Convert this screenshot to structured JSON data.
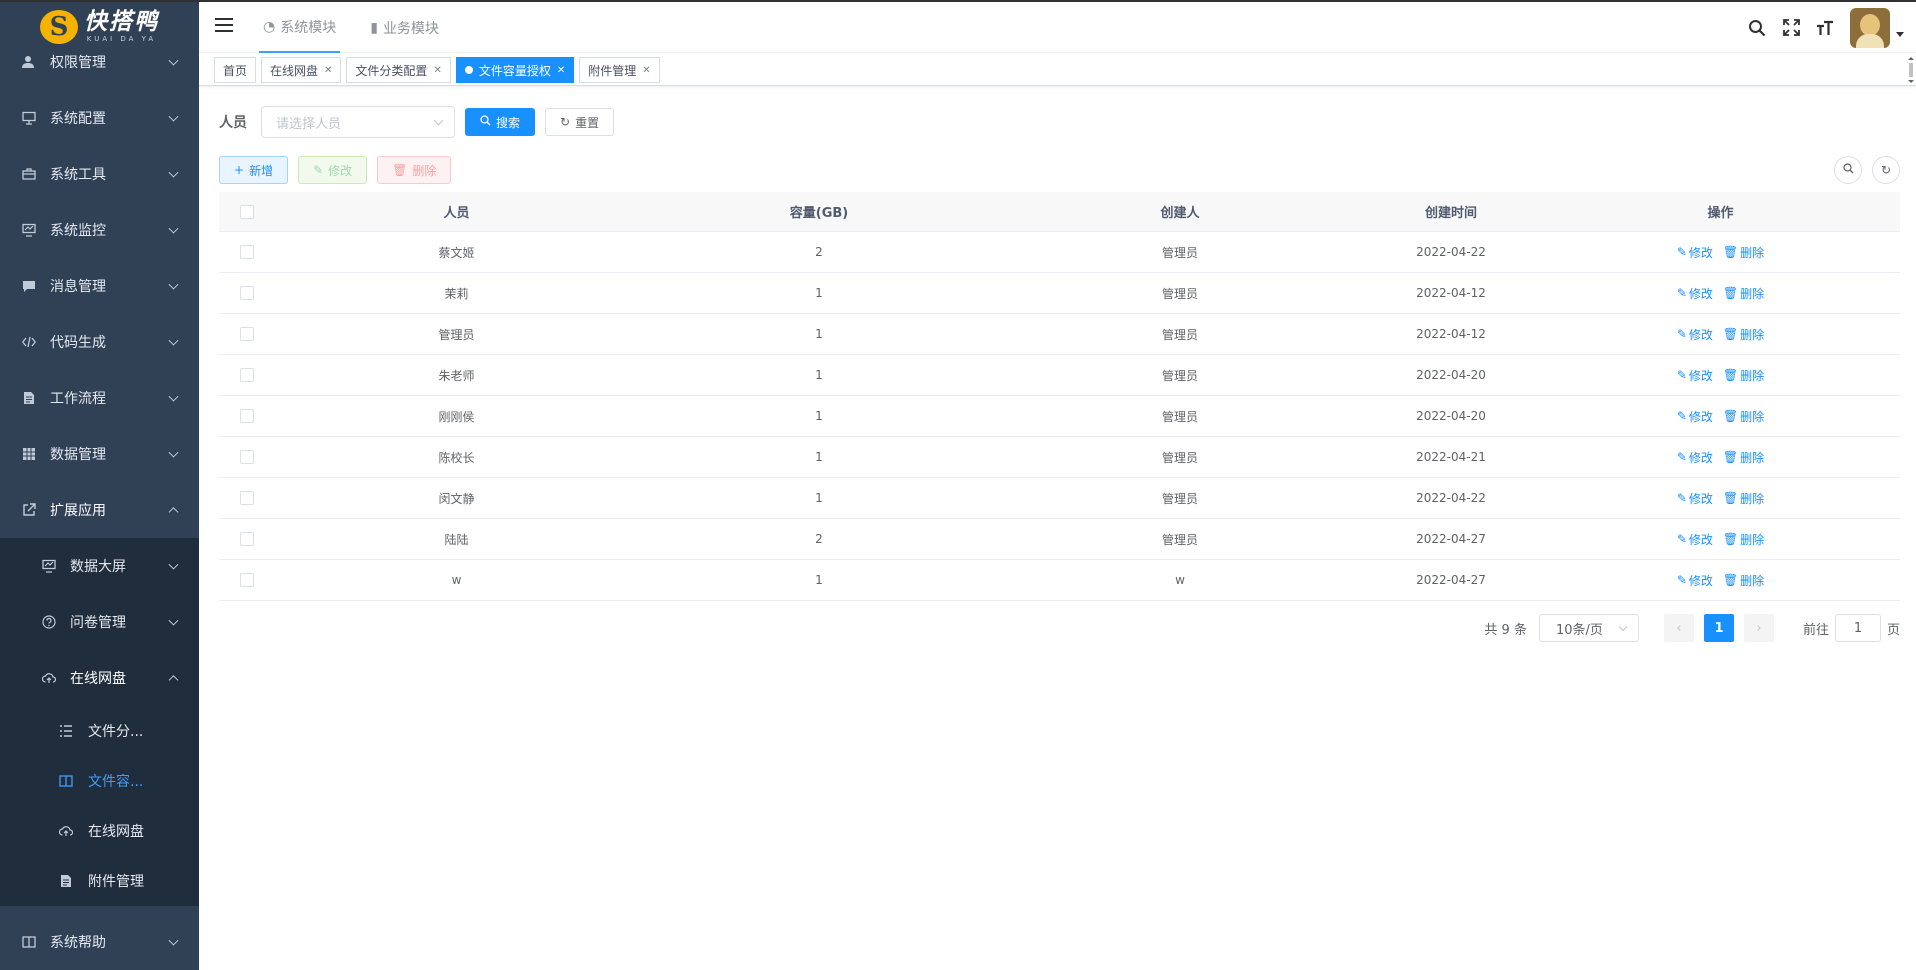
{
  "logo": {
    "mark": "S",
    "title": "快搭鸭",
    "subtitle": "KUAI DA YA"
  },
  "sidebar": {
    "items": [
      {
        "label": "权限管理",
        "icon": "user-icon"
      },
      {
        "label": "系统配置",
        "icon": "monitor-icon"
      },
      {
        "label": "系统工具",
        "icon": "toolbox-icon"
      },
      {
        "label": "系统监控",
        "icon": "chart-monitor-icon"
      },
      {
        "label": "消息管理",
        "icon": "message-icon"
      },
      {
        "label": "代码生成",
        "icon": "code-icon"
      },
      {
        "label": "工作流程",
        "icon": "document-icon"
      },
      {
        "label": "数据管理",
        "icon": "table-icon"
      },
      {
        "label": "扩展应用",
        "icon": "external-link-icon"
      }
    ],
    "ext_sub": [
      {
        "label": "数据大屏",
        "icon": "screen-icon"
      },
      {
        "label": "问卷管理",
        "icon": "question-icon"
      },
      {
        "label": "在线网盘",
        "icon": "cloud-upload-icon"
      }
    ],
    "disk_sub": [
      {
        "label": "文件分...",
        "icon": "list-icon"
      },
      {
        "label": "文件容...",
        "icon": "columns-icon"
      },
      {
        "label": "在线网盘",
        "icon": "cloud-upload-icon"
      },
      {
        "label": "附件管理",
        "icon": "file-icon"
      }
    ],
    "help": {
      "label": "系统帮助",
      "icon": "book-icon"
    }
  },
  "navbar": {
    "modules": [
      {
        "label": "系统模块",
        "icon": "dashboard-icon"
      },
      {
        "label": "业务模块",
        "icon": "door-icon"
      }
    ]
  },
  "tags": [
    {
      "label": "首页"
    },
    {
      "label": "在线网盘"
    },
    {
      "label": "文件分类配置"
    },
    {
      "label": "文件容量授权"
    },
    {
      "label": "附件管理"
    }
  ],
  "search": {
    "label": "人员",
    "placeholder": "请选择人员",
    "search_btn": "搜索",
    "reset_btn": "重置"
  },
  "toolbar": {
    "add": "新增",
    "edit": "修改",
    "delete": "删除"
  },
  "table": {
    "headers": {
      "user": "人员",
      "capacity": "容量(GB)",
      "creator": "创建人",
      "time": "创建时间",
      "ops": "操作"
    },
    "op_edit": "修改",
    "op_delete": "删除",
    "rows": [
      {
        "user": "蔡文姬",
        "capacity": "2",
        "creator": "管理员",
        "time": "2022-04-22"
      },
      {
        "user": "茉莉",
        "capacity": "1",
        "creator": "管理员",
        "time": "2022-04-12"
      },
      {
        "user": "管理员",
        "capacity": "1",
        "creator": "管理员",
        "time": "2022-04-12"
      },
      {
        "user": "朱老师",
        "capacity": "1",
        "creator": "管理员",
        "time": "2022-04-20"
      },
      {
        "user": "刚刚侯",
        "capacity": "1",
        "creator": "管理员",
        "time": "2022-04-20"
      },
      {
        "user": "陈校长",
        "capacity": "1",
        "creator": "管理员",
        "time": "2022-04-21"
      },
      {
        "user": "闵文静",
        "capacity": "1",
        "creator": "管理员",
        "time": "2022-04-22"
      },
      {
        "user": "陆陆",
        "capacity": "2",
        "creator": "管理员",
        "time": "2022-04-27"
      },
      {
        "user": "w",
        "capacity": "1",
        "creator": "w",
        "time": "2022-04-27"
      }
    ]
  },
  "pagination": {
    "total": "共 9 条",
    "page_size": "10条/页",
    "current": "1",
    "goto_prefix": "前往",
    "goto_value": "1",
    "goto_suffix": "页"
  },
  "colors": {
    "primary": "#1890ff",
    "sidebar_bg": "#304156",
    "sidebar_sub_bg": "#1f2d3d"
  }
}
